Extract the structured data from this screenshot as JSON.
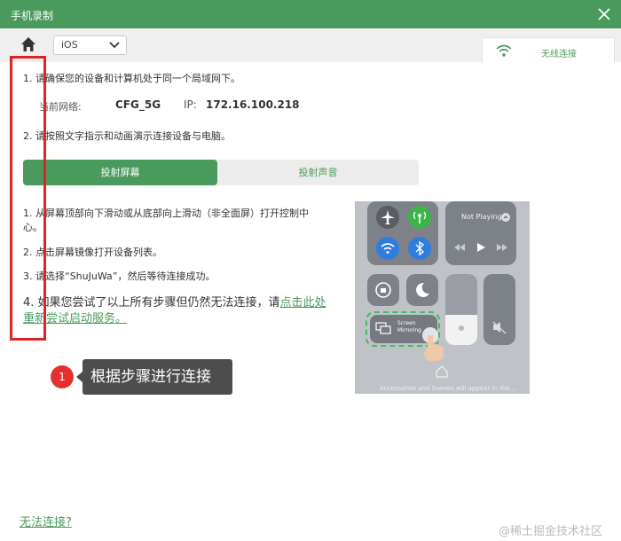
{
  "window": {
    "title": "手机录制"
  },
  "toolbar": {
    "os_selected": "iOS"
  },
  "tabs": {
    "wireless_label": "无线连接"
  },
  "steps": {
    "step1": "1. 请确保您的设备和计算机处于同一个局域网下。",
    "step2": "2. 请按照文字指示和动画演示连接设备与电脑。"
  },
  "network": {
    "label": "当前网络:",
    "name": "CFG_5G",
    "ip_label": "IP:",
    "ip": "172.16.100.218"
  },
  "segment": {
    "screen_label": "投射屏幕",
    "audio_label": "投射声音"
  },
  "instructions": {
    "i1": "1. 从屏幕顶部向下滑动或从底部向上滑动（非全面屏）打开控制中心。",
    "i2": "2. 点击屏幕镜像打开设备列表。",
    "i3": "3. 请选择“ShuJuWa”，然后等待连接成功。",
    "i4_prefix": "4. 如果您尝试了以上所有步骤但仍然无法连接，请",
    "i4_link": "点击此处重新尝试启动服务。"
  },
  "annotation": {
    "number": "1",
    "text": "根据步骤进行连接"
  },
  "phone_preview": {
    "not_playing": "Not Playing",
    "screen_mirroring": "Screen Mirroring",
    "caption": "Accessories and Scenes will appear in the..."
  },
  "footer": {
    "cannot_connect": "无法连接?",
    "watermark": "@稀土掘金技术社区"
  },
  "colors": {
    "accent": "#4a9a5e",
    "highlight": "#e02323",
    "badge": "#e5302e"
  }
}
